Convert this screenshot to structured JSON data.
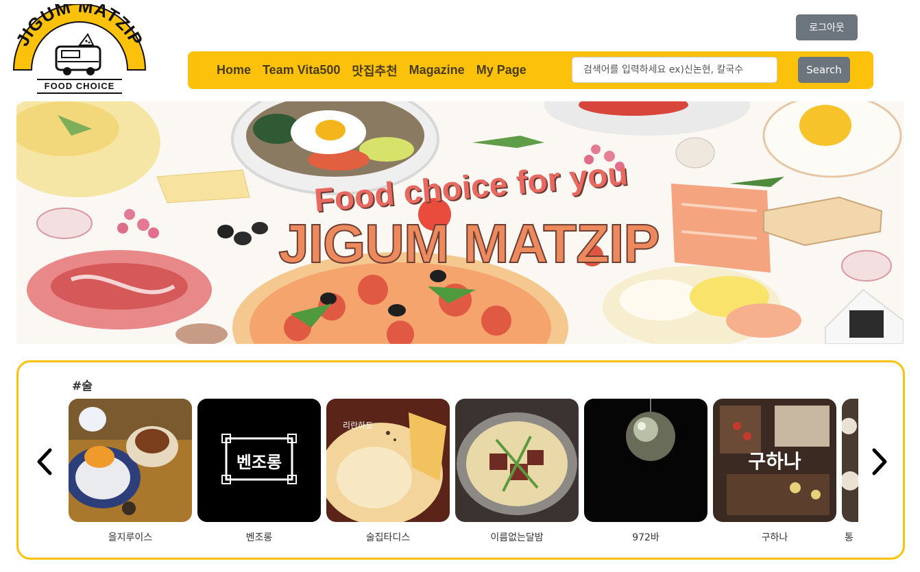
{
  "logo": {
    "arc_text": "JIGUM MATZIP",
    "sub_text": "FOOD CHOICE"
  },
  "header": {
    "logout_label": "로그아웃"
  },
  "nav": {
    "links": [
      "Home",
      "Team Vita500",
      "맛집추천",
      "Magazine",
      "My Page"
    ],
    "search_placeholder": "검색어를 입력하세요 ex)신논현, 칼국수",
    "search_label": "Search"
  },
  "banner": {
    "subtitle": "Food choice for you",
    "title": "JIGUM MATZIP"
  },
  "section": {
    "tag": "#술",
    "cards": [
      {
        "name": "을지루이스",
        "overlay": ""
      },
      {
        "name": "벤조롱",
        "overlay": "벤조롱"
      },
      {
        "name": "술집타디스",
        "overlay": "리란하트"
      },
      {
        "name": "이름없는달밤",
        "overlay": ""
      },
      {
        "name": "972바",
        "overlay": ""
      },
      {
        "name": "구하나",
        "overlay": "구하나"
      },
      {
        "name": "통",
        "overlay": ""
      }
    ]
  },
  "colors": {
    "accent": "#fbc10b",
    "button_gray": "#6c757d",
    "banner_title": "#ec8a5e"
  },
  "icons": {
    "prev": "chevron-left-icon",
    "next": "chevron-right-icon"
  }
}
